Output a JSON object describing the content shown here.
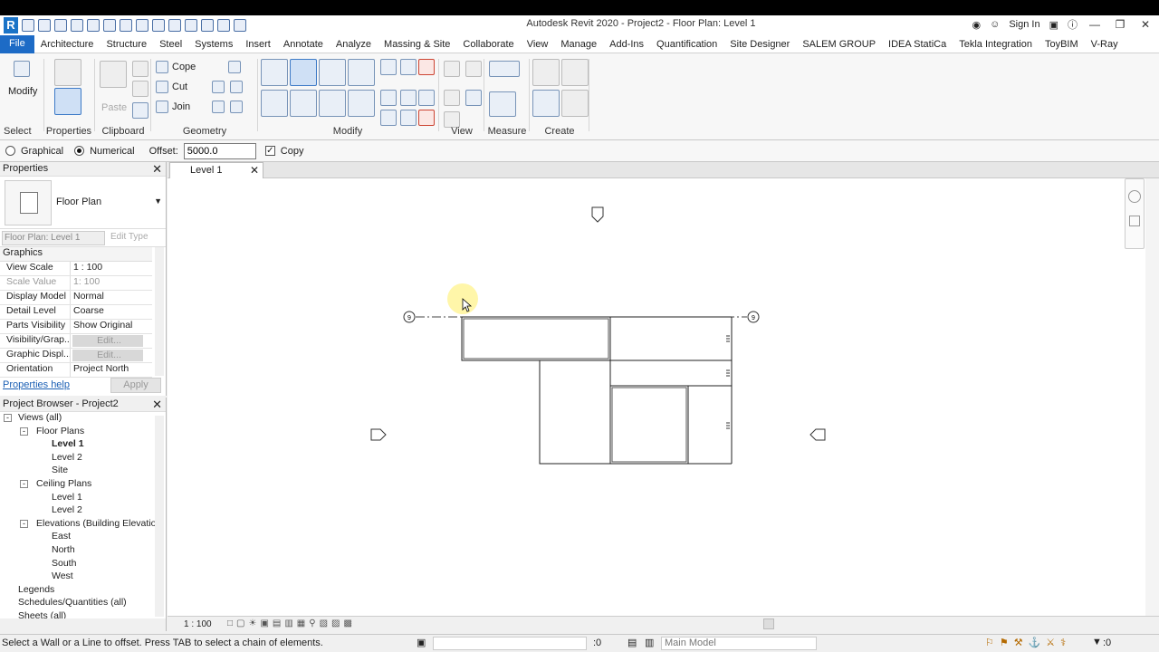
{
  "app": {
    "title": "Autodesk Revit 2020 - Project2 - Floor Plan: Level 1",
    "sign_in": "Sign In",
    "logo": "R"
  },
  "menu": {
    "file": "File",
    "tabs": [
      "Architecture",
      "Structure",
      "Steel",
      "Systems",
      "Insert",
      "Annotate",
      "Analyze",
      "Massing & Site",
      "Collaborate",
      "View",
      "Manage",
      "Add-Ins",
      "Quantification",
      "Site Designer",
      "SALEM GROUP",
      "IDEA StatiCa",
      "Tekla Integration",
      "ToyBIM",
      "V-Ray"
    ]
  },
  "ribbon": {
    "select": {
      "modify": "Modify",
      "label": "Select"
    },
    "properties": {
      "label": "Properties"
    },
    "clipboard": {
      "paste": "Paste",
      "label": "Clipboard"
    },
    "geometry": {
      "cope": "Cope",
      "cut": "Cut",
      "join": "Join",
      "label": "Geometry"
    },
    "modify_panel": {
      "label": "Modify"
    },
    "view_panel": {
      "label": "View"
    },
    "measure_panel": {
      "label": "Measure"
    },
    "create_panel": {
      "label": "Create"
    }
  },
  "options": {
    "graphical": "Graphical",
    "numerical": "Numerical",
    "offset_label": "Offset:",
    "offset_value": "5000.0",
    "copy": "Copy"
  },
  "properties": {
    "header": "Properties",
    "type_name": "Floor Plan",
    "instance": "Floor Plan: Level 1",
    "edit_type": "Edit Type",
    "group": "Graphics",
    "rows": [
      {
        "k": "View Scale",
        "v": "1 : 100"
      },
      {
        "k": "Scale Value",
        "v": "1: 100"
      },
      {
        "k": "Display Model",
        "v": "Normal"
      },
      {
        "k": "Detail Level",
        "v": "Coarse"
      },
      {
        "k": "Parts Visibility",
        "v": "Show Original"
      },
      {
        "k": "Visibility/Grap...",
        "v": "Edit..."
      },
      {
        "k": "Graphic Displ...",
        "v": "Edit..."
      },
      {
        "k": "Orientation",
        "v": "Project North"
      }
    ],
    "help": "Properties help",
    "apply": "Apply"
  },
  "browser": {
    "header": "Project Browser - Project2",
    "items": [
      {
        "label": "Views (all)",
        "level": 0
      },
      {
        "label": "Floor Plans",
        "level": 1
      },
      {
        "label": "Level 1",
        "level": 2
      },
      {
        "label": "Level 2",
        "level": 2
      },
      {
        "label": "Site",
        "level": 2
      },
      {
        "label": "Ceiling Plans",
        "level": 1
      },
      {
        "label": "Level 1",
        "level": 2
      },
      {
        "label": "Level 2",
        "level": 2
      },
      {
        "label": "Elevations (Building Elevatio",
        "level": 1
      },
      {
        "label": "East",
        "level": 2
      },
      {
        "label": "North",
        "level": 2
      },
      {
        "label": "South",
        "level": 2
      },
      {
        "label": "West",
        "level": 2
      },
      {
        "label": "Legends",
        "level": 0
      },
      {
        "label": "Schedules/Quantities (all)",
        "level": 0
      },
      {
        "label": "Sheets (all)",
        "level": 0
      }
    ]
  },
  "view": {
    "tab": "Level 1",
    "scale": "1 : 100",
    "grid_bubble": "9"
  },
  "status": {
    "message": "Select a Wall or a Line to offset. Press TAB to select a chain of elements.",
    "count": ":0",
    "model": "Main Model",
    "filter_count": ":0"
  },
  "colors": {
    "accent": "#1d6bc6",
    "cursor_highlight": "#fff59a"
  }
}
